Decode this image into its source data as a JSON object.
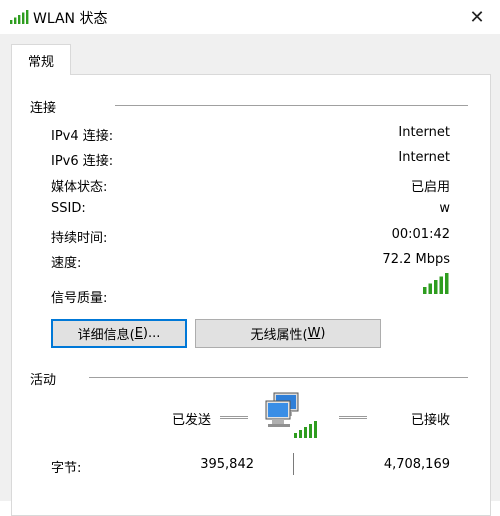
{
  "window": {
    "title": "WLAN 状态",
    "close_glyph": "✕",
    "signal_icon": "wifi-signal-bars-icon",
    "accent_color": "#0078d7",
    "signal_color": "#2e9d1f"
  },
  "tabs": [
    {
      "label": "常规",
      "selected": true
    }
  ],
  "connection": {
    "heading": "连接",
    "rows": [
      {
        "label": "IPv4 连接:",
        "value": "Internet"
      },
      {
        "label": "IPv6 连接:",
        "value": "Internet"
      },
      {
        "label": "媒体状态:",
        "value": "已启用"
      },
      {
        "label": "SSID:",
        "value": "w"
      },
      {
        "label": "持续时间:",
        "value": "00:01:42"
      },
      {
        "label": "速度:",
        "value": "72.2 Mbps"
      },
      {
        "label": "信号质量:",
        "value_icon": "signal-strength-icon",
        "signal_bars": 5
      }
    ],
    "details_button": {
      "label": "详细信息(",
      "accel": "E",
      "suffix": ")..."
    },
    "wireless_button": {
      "label": "无线属性(",
      "accel": "W",
      "suffix": ")"
    }
  },
  "activity": {
    "heading": "活动",
    "sent_label": "已发送",
    "received_label": "已接收",
    "network_icon": "network-computers-icon",
    "bytes_label": "字节:",
    "bytes_sent": "395,842",
    "bytes_received": "4,708,169"
  }
}
